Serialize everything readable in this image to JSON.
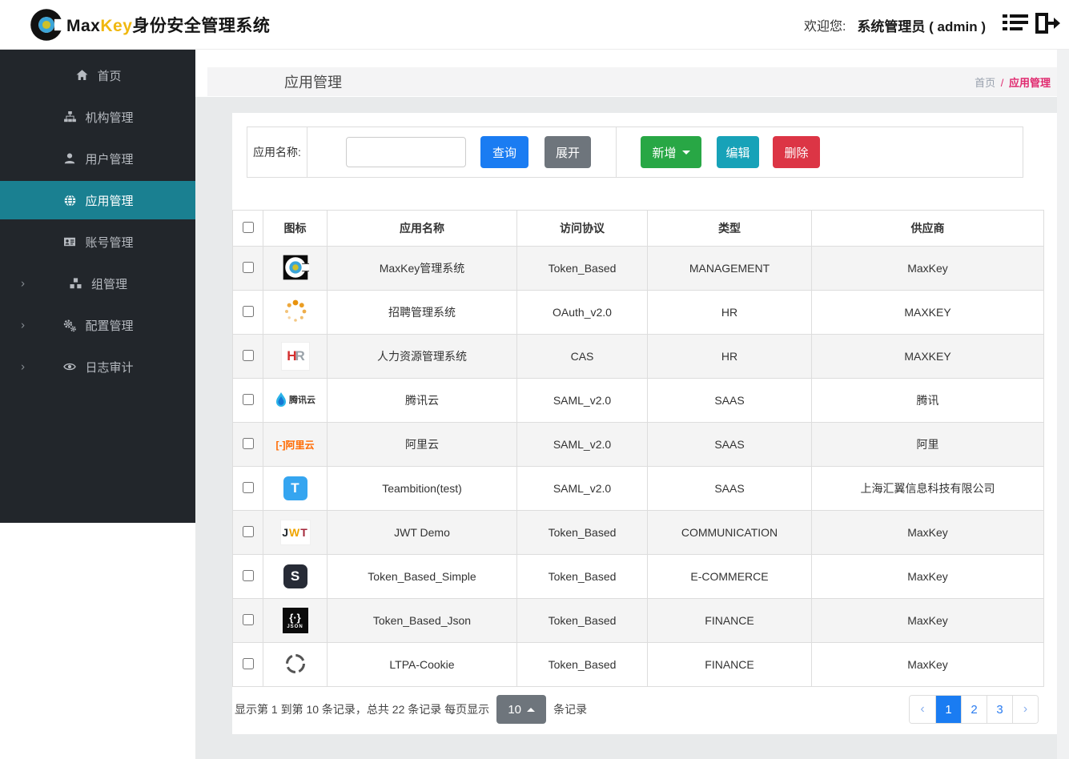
{
  "colors": {
    "primary_blue": "#1a7cf2",
    "success_green": "#28a745",
    "info_teal": "#17a2b8",
    "danger_red": "#dc3545",
    "secondary_gray": "#6e757c",
    "sidebar_dark": "#22262b",
    "sidebar_active_teal": "#1a8091",
    "breadcrumb_pink": "#e02a6f",
    "brand_gold": "#f0b810"
  },
  "topbar": {
    "brand_max": "Max",
    "brand_key": "Key",
    "brand_suffix": "身份安全管理系统",
    "welcome_label": "欢迎您:",
    "username": "系统管理员 ( admin )"
  },
  "sidebar": {
    "items": [
      {
        "label": "首页",
        "icon": "home-icon",
        "active": false,
        "expandable": false
      },
      {
        "label": "机构管理",
        "icon": "sitemap-icon",
        "active": false,
        "expandable": false
      },
      {
        "label": "用户管理",
        "icon": "user-icon",
        "active": false,
        "expandable": false
      },
      {
        "label": "应用管理",
        "icon": "globe-icon",
        "active": true,
        "expandable": false
      },
      {
        "label": "账号管理",
        "icon": "id-card-icon",
        "active": false,
        "expandable": false
      },
      {
        "label": "组管理",
        "icon": "cubes-icon",
        "active": false,
        "expandable": true
      },
      {
        "label": "配置管理",
        "icon": "gears-icon",
        "active": false,
        "expandable": true
      },
      {
        "label": "日志审计",
        "icon": "eye-icon",
        "active": false,
        "expandable": true
      }
    ]
  },
  "page_header": {
    "title": "应用管理",
    "breadcrumb_home": "首页",
    "breadcrumb_separator": "/",
    "breadcrumb_current": "应用管理"
  },
  "toolbar": {
    "search_label": "应用名称:",
    "search_value": "",
    "query_label": "查询",
    "expand_label": "展开",
    "add_label": "新增",
    "edit_label": "编辑",
    "delete_label": "删除"
  },
  "table": {
    "columns": {
      "icon": "图标",
      "name": "应用名称",
      "protocol": "访问协议",
      "category": "类型",
      "vendor": "供应商"
    },
    "rows": [
      {
        "icon": "maxkey-logo-icon",
        "name": "MaxKey管理系统",
        "protocol": "Token_Based",
        "category": "MANAGEMENT",
        "vendor": "MaxKey"
      },
      {
        "icon": "spinner-dots-icon",
        "name": "招聘管理系统",
        "protocol": "OAuth_v2.0",
        "category": "HR",
        "vendor": "MAXKEY"
      },
      {
        "icon": "hr-logo-icon",
        "icon_text_h": "H",
        "icon_text_r": "R",
        "name": "人力资源管理系统",
        "protocol": "CAS",
        "category": "HR",
        "vendor": "MAXKEY"
      },
      {
        "icon": "tencent-cloud-icon",
        "icon_text": "腾讯云",
        "name": "腾讯云",
        "protocol": "SAML_v2.0",
        "category": "SAAS",
        "vendor": "腾讯"
      },
      {
        "icon": "aliyun-icon",
        "icon_text": "[-]阿里云",
        "name": "阿里云",
        "protocol": "SAML_v2.0",
        "category": "SAAS",
        "vendor": "阿里"
      },
      {
        "icon": "teambition-icon",
        "icon_text": "T",
        "name": "Teambition(test)",
        "protocol": "SAML_v2.0",
        "category": "SAAS",
        "vendor": "上海汇翼信息科技有限公司"
      },
      {
        "icon": "jwt-logo-icon",
        "icon_text_j": "J",
        "icon_text_w": "W",
        "icon_text_t": "T",
        "name": "JWT Demo",
        "protocol": "Token_Based",
        "category": "COMMUNICATION",
        "vendor": "MaxKey"
      },
      {
        "icon": "s-logo-icon",
        "icon_text": "S",
        "name": "Token_Based_Simple",
        "protocol": "Token_Based",
        "category": "E-COMMERCE",
        "vendor": "MaxKey"
      },
      {
        "icon": "json-logo-icon",
        "icon_braces": "{·}",
        "icon_label": "JSON",
        "name": "Token_Based_Json",
        "protocol": "Token_Based",
        "category": "FINANCE",
        "vendor": "MaxKey"
      },
      {
        "icon": "target-circle-icon",
        "name": "LTPA-Cookie",
        "protocol": "Token_Based",
        "category": "FINANCE",
        "vendor": "MaxKey"
      }
    ]
  },
  "pagination": {
    "info_prefix": "显示第 1 到第 10 条记录，总共 22 条记录 每页显示",
    "page_size": "10",
    "info_suffix": "条记录",
    "prev": "‹",
    "next": "›",
    "pages": [
      "1",
      "2",
      "3"
    ],
    "active_page": "1"
  }
}
